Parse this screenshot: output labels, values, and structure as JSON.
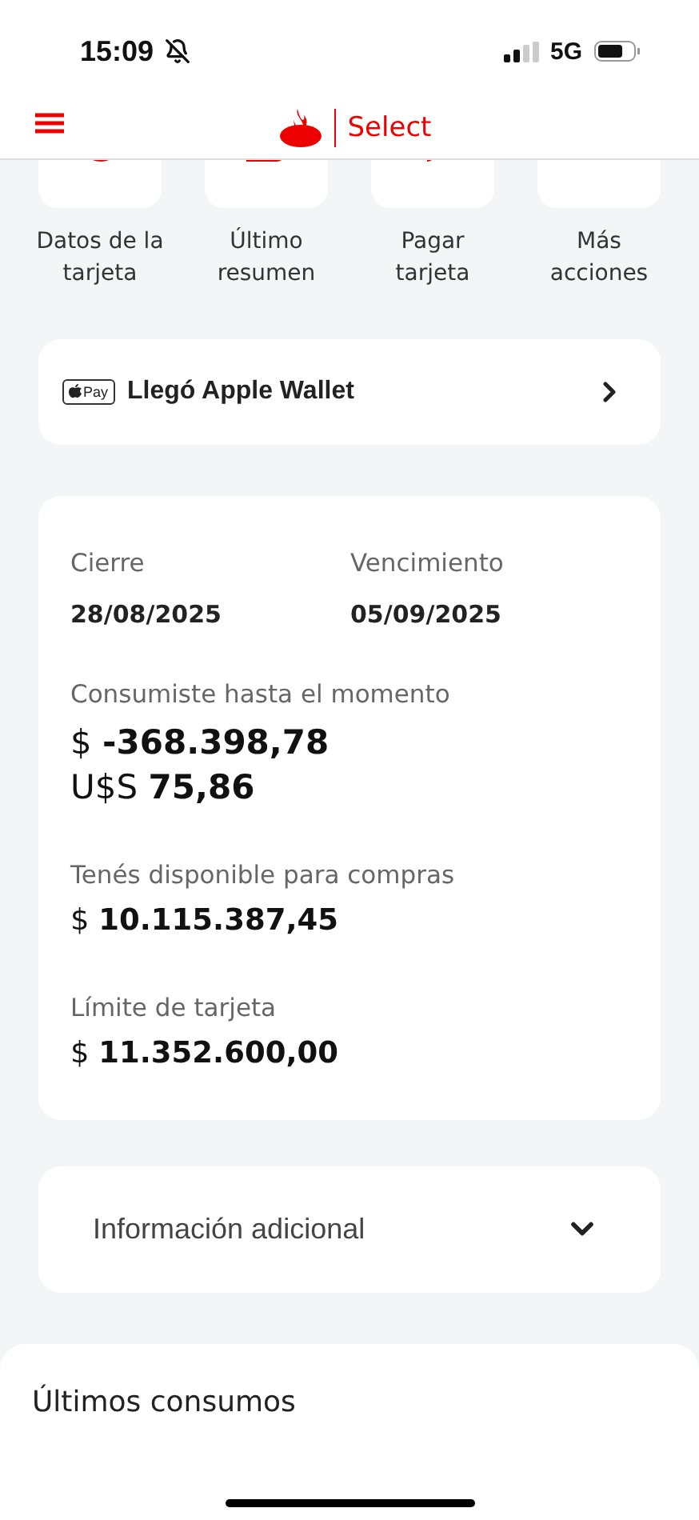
{
  "status_bar": {
    "time": "15:09",
    "network": "5G"
  },
  "header": {
    "title": "Select"
  },
  "actions": [
    {
      "label": "Datos de la tarjeta",
      "kind": "card-data"
    },
    {
      "label": "Último resumen",
      "kind": "statement"
    },
    {
      "label": "Pagar tarjeta",
      "kind": "pay"
    },
    {
      "label": "Más acciones",
      "kind": "more"
    }
  ],
  "promo": {
    "badge": "Pay",
    "text": "Llegó Apple Wallet"
  },
  "summary": {
    "closing": {
      "label": "Cierre",
      "value": "28/08/2025"
    },
    "due": {
      "label": "Vencimiento",
      "value": "05/09/2025"
    },
    "spent": {
      "label": "Consumiste hasta el momento",
      "lines": [
        "$ **-368.398,78**",
        "U$S **75,86**"
      ]
    },
    "available": {
      "label": "Tenés disponible para compras",
      "value": "$ **10.115.387,45**"
    },
    "limit": {
      "label": "Límite de tarjeta",
      "value": "$ **11.352.600,00**"
    }
  },
  "additional": {
    "label": "Información adicional",
    "expanded": false
  },
  "recent": {
    "title": "Últimos consumos"
  }
}
